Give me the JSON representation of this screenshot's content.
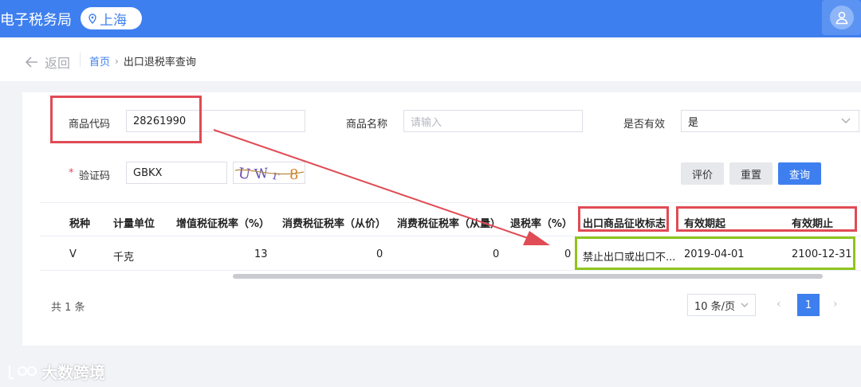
{
  "header": {
    "app_title": "电子税务局",
    "region": "上海",
    "location_icon": "location-pin-icon",
    "avatar_icon": "user-avatar-icon",
    "brand_color": "#3e7fef"
  },
  "subnav": {
    "back_label": "返回",
    "breadcrumb": {
      "home": "首页",
      "separator": "›",
      "current": "出口退税率查询"
    }
  },
  "search_form": {
    "code_label": "商品代码",
    "code_value": "28261990",
    "name_label": "商品名称",
    "name_placeholder": "请输入",
    "valid_label": "是否有效",
    "valid_value": "是",
    "required_mark": "*",
    "captcha_label": "验证码",
    "captcha_value": "GBKX",
    "captcha_image_text": "UWr8",
    "buttons": {
      "evaluate": "评价",
      "reset": "重置",
      "query": "查询"
    }
  },
  "table": {
    "columns": [
      "税种",
      "计量单位",
      "增值税征税率（%）",
      "消费税征税率（从价）",
      "消费税征税率（从量）",
      "退税率（%）",
      "出口商品征收标志",
      "有效期起",
      "有效期止"
    ],
    "rows": [
      [
        "V",
        "千克",
        "13",
        "0",
        "0",
        "0",
        "禁止出口或出口不...",
        "2019-04-01",
        "2100-12-31"
      ]
    ]
  },
  "pagination": {
    "total": "共 1 条",
    "page_size": "10 条/页",
    "prev": "‹",
    "current_page": "1",
    "next": "›"
  },
  "annotation_colors": {
    "red": "#e04b55",
    "green": "#8ec51c"
  },
  "watermark": {
    "text": "大数跨境"
  }
}
